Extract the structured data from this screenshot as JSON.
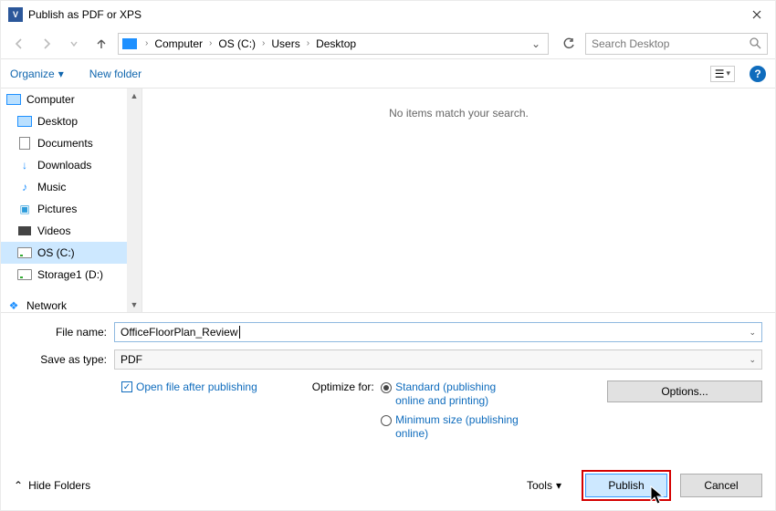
{
  "title": "Publish as PDF or XPS",
  "app_icon_label": "V",
  "breadcrumb": {
    "segments": [
      "Computer",
      "OS (C:)",
      "Users",
      "Desktop"
    ]
  },
  "search": {
    "placeholder": "Search Desktop"
  },
  "toolbar": {
    "organize": "Organize",
    "newfolder": "New folder"
  },
  "sidebar": {
    "items": [
      {
        "name": "computer",
        "label": "Computer"
      },
      {
        "name": "desktop",
        "label": "Desktop"
      },
      {
        "name": "documents",
        "label": "Documents"
      },
      {
        "name": "downloads",
        "label": "Downloads"
      },
      {
        "name": "music",
        "label": "Music"
      },
      {
        "name": "pictures",
        "label": "Pictures"
      },
      {
        "name": "videos",
        "label": "Videos"
      },
      {
        "name": "osc",
        "label": "OS (C:)"
      },
      {
        "name": "storage1",
        "label": "Storage1 (D:)"
      },
      {
        "name": "network",
        "label": "Network"
      }
    ]
  },
  "content": {
    "empty": "No items match your search."
  },
  "fields": {
    "filename_label": "File name:",
    "filename_value": "OfficeFloorPlan_Review",
    "savetype_label": "Save as type:",
    "savetype_value": "PDF"
  },
  "open_after": "Open file after publishing",
  "optimize": {
    "label": "Optimize for:",
    "standard": "Standard (publishing online and printing)",
    "minimum": "Minimum size (publishing online)"
  },
  "options_btn": "Options...",
  "footer": {
    "hide_folders": "Hide Folders",
    "tools": "Tools",
    "publish": "Publish",
    "cancel": "Cancel"
  }
}
